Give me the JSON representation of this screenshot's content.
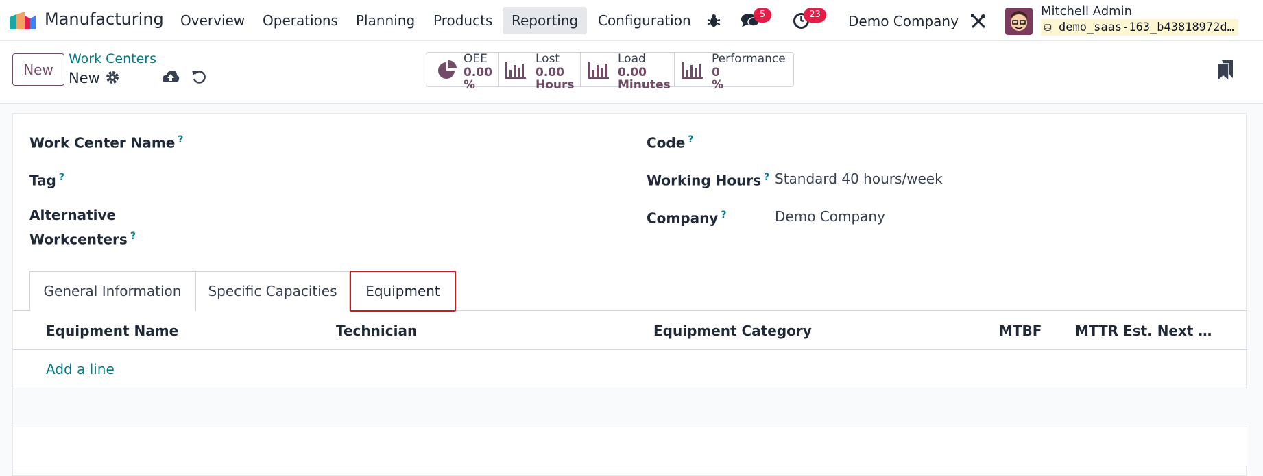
{
  "navbar": {
    "app_name": "Manufacturing",
    "menu": [
      "Overview",
      "Operations",
      "Planning",
      "Products",
      "Reporting",
      "Configuration"
    ],
    "active_menu": "Reporting",
    "messages_count": "5",
    "activities_count": "23",
    "company": "Demo Company",
    "user_name": "Mitchell Admin",
    "database": "demo_saas-163_b43818972d…",
    "colors": {
      "badge": "#e11d48"
    }
  },
  "control": {
    "new_label": "New",
    "breadcrumb": "Work Centers",
    "record_name": "New"
  },
  "stats": [
    {
      "label": "OEE",
      "value": "0.00",
      "unit": "%",
      "icon": "pie-chart-icon"
    },
    {
      "label": "Lost",
      "value": "0.00",
      "unit": "Hours",
      "icon": "bar-chart-icon"
    },
    {
      "label": "Load",
      "value": "0.00",
      "unit": "Minutes",
      "icon": "bar-chart-icon"
    },
    {
      "label": "Performance",
      "value": "0",
      "unit": "%",
      "icon": "bar-chart-icon"
    }
  ],
  "form": {
    "work_center_name_label": "Work Center Name",
    "tag_label": "Tag",
    "alt_workcenters_label_1": "Alternative",
    "alt_workcenters_label_2": "Workcenters",
    "code_label": "Code",
    "working_hours_label": "Working Hours",
    "working_hours_value": "Standard 40 hours/week",
    "company_label": "Company",
    "company_value": "Demo Company",
    "help_marker": "?"
  },
  "tabs": [
    {
      "label": "General Information"
    },
    {
      "label": "Specific Capacities"
    },
    {
      "label": "Equipment"
    }
  ],
  "active_tab": "Equipment",
  "equipment_table": {
    "columns": [
      "Equipment Name",
      "Technician",
      "Equipment Category",
      "MTBF",
      "MTTR",
      "Est. Next …"
    ],
    "add_line": "Add a line"
  },
  "colors": {
    "brand": "#714b67",
    "link": "#017e84",
    "highlight": "#c81e1e"
  }
}
